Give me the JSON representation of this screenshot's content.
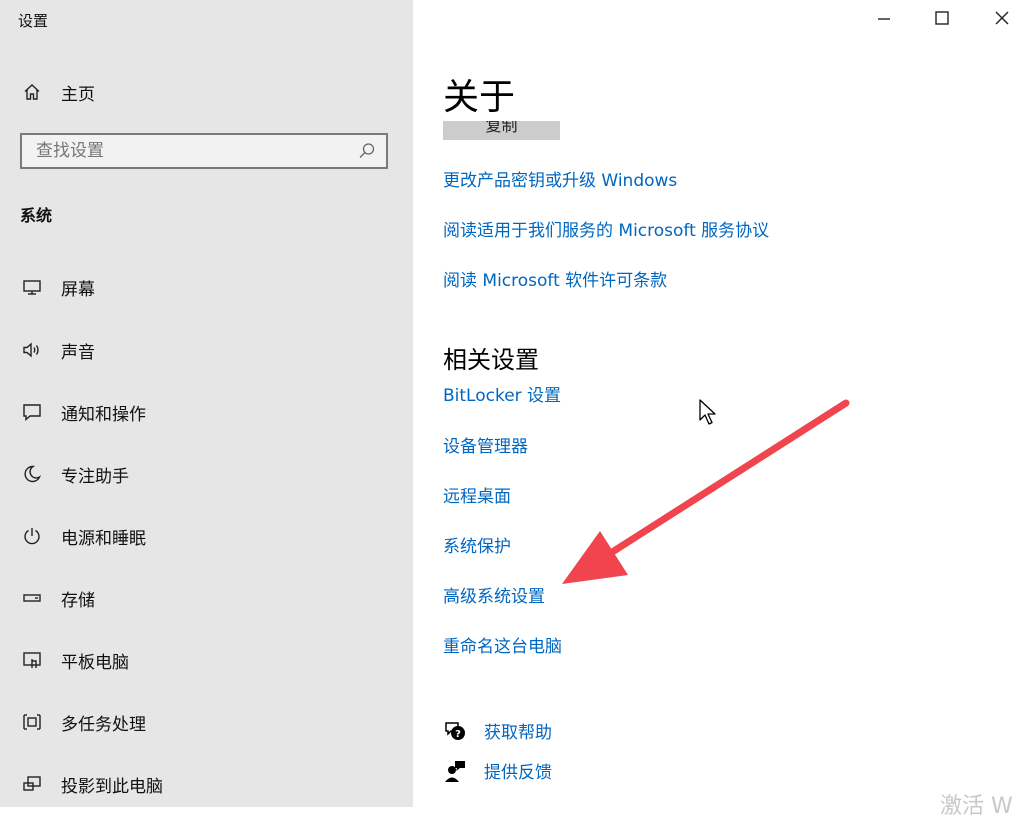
{
  "window": {
    "title": "设置"
  },
  "sidebar": {
    "home": {
      "label": "主页",
      "icon": "home-icon"
    },
    "search": {
      "placeholder": "查找设置",
      "icon": "search-icon"
    },
    "section": "系统",
    "items": [
      {
        "label": "屏幕",
        "icon": "display-icon"
      },
      {
        "label": "声音",
        "icon": "speaker-icon"
      },
      {
        "label": "通知和操作",
        "icon": "notification-icon"
      },
      {
        "label": "专注助手",
        "icon": "moon-icon"
      },
      {
        "label": "电源和睡眠",
        "icon": "power-icon"
      },
      {
        "label": "存储",
        "icon": "storage-icon"
      },
      {
        "label": "平板电脑",
        "icon": "tablet-icon"
      },
      {
        "label": "多任务处理",
        "icon": "multitask-icon"
      },
      {
        "label": "投影到此电脑",
        "icon": "project-icon"
      }
    ]
  },
  "main": {
    "title": "关于",
    "copy_button": "复制",
    "links": [
      "更改产品密钥或升级 Windows",
      "阅读适用于我们服务的 Microsoft 服务协议",
      "阅读 Microsoft 软件许可条款"
    ],
    "related": {
      "title": "相关设置",
      "links": [
        "BitLocker 设置",
        "设备管理器",
        "远程桌面",
        "系统保护",
        "高级系统设置",
        "重命名这台电脑"
      ]
    },
    "help": [
      {
        "label": "获取帮助",
        "icon": "help-chat-icon"
      },
      {
        "label": "提供反馈",
        "icon": "feedback-icon"
      }
    ],
    "watermark": "激活 W"
  },
  "colors": {
    "sidebar_bg": "#e6e6e6",
    "link": "#0067c0",
    "annotation_arrow": "#f0444e"
  }
}
